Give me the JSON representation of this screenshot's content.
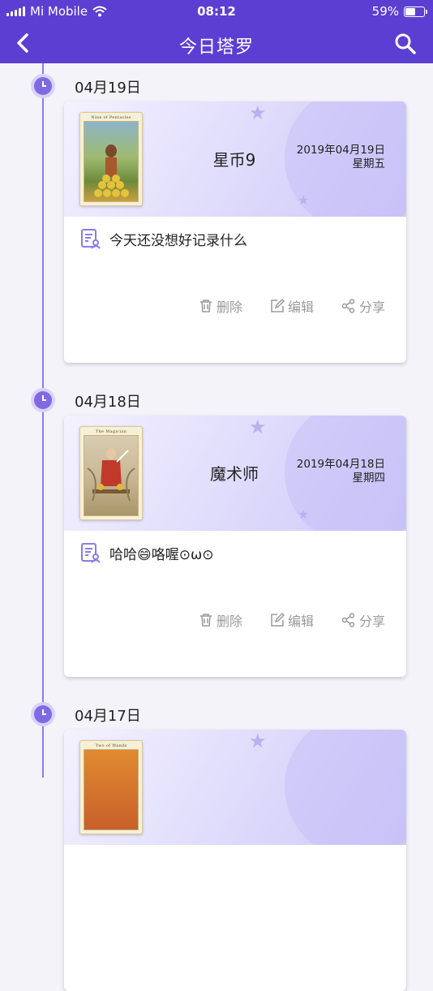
{
  "status_bar": {
    "carrier": "Mi Mobile",
    "time": "08:12",
    "battery": "59%",
    "battery_level": 0.59
  },
  "nav": {
    "title": "今日塔罗"
  },
  "actions": {
    "delete": "删除",
    "edit": "编辑",
    "share": "分享"
  },
  "entries": [
    {
      "date_label": "04月19日",
      "card_name": "星币9",
      "date": "2019年04月19日",
      "weekday": "星期五",
      "note": "今天还没想好记录什么",
      "tarot_caption": "Nine of Pentacles"
    },
    {
      "date_label": "04月18日",
      "card_name": "魔术师",
      "date": "2019年04月18日",
      "weekday": "星期四",
      "note": "哈哈😄咯喔⊙ω⊙",
      "tarot_caption": "The Magician"
    },
    {
      "date_label": "04月17日",
      "card_name": "",
      "date": "",
      "weekday": "",
      "note": "",
      "tarot_caption": "Two of Wands"
    }
  ],
  "colors": {
    "header": "#5b3fd3",
    "timeline": "#8b7de6",
    "card_gradient": "#dcd8fb"
  }
}
